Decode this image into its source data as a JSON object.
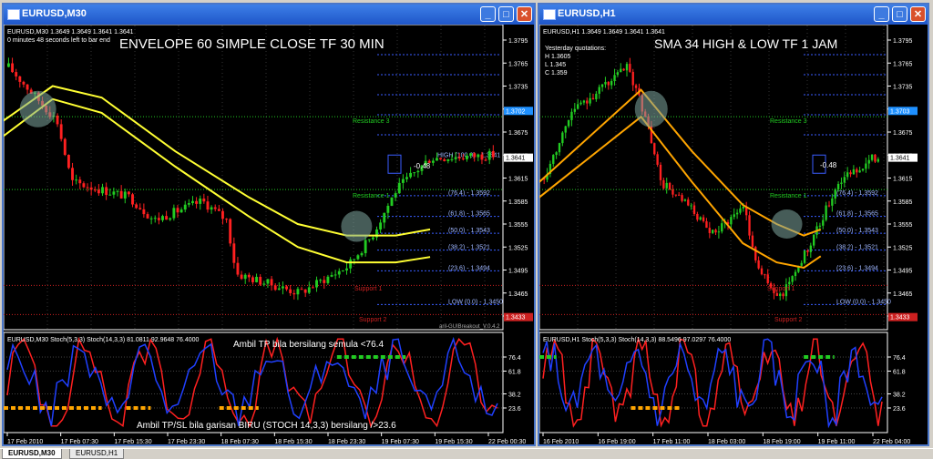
{
  "left": {
    "window_title": "EURUSD,M30",
    "symbol_line": "EURUSD,M30  1.3649 1.3649 1.3641 1.3641",
    "timer": "0 minutes 48 seconds left to bar end",
    "headline": "ENVELOPE 60 SIMPLE CLOSE TF 30 MIN",
    "price_labels": [
      "1.3795",
      "1.3765",
      "1.3735",
      "1.3705",
      "1.3675",
      "1.3645",
      "1.3615",
      "1.3585",
      "1.3555",
      "1.3525",
      "1.3495",
      "1.3465",
      "1.3435"
    ],
    "price_tag_current": "1.3641",
    "price_tag_high": "1.3702",
    "price_tag_low": "1.3433",
    "fib_labels": [
      "(76.4) - 1.3592",
      "(61.8) - 1.3565",
      "(50.0) - 1.3543",
      "(38.2) - 1.3521",
      "(23.6) - 1.3494",
      "LOW (0.0) - 1.3450"
    ],
    "high_label": "HIGH (100.0) - 1.3641",
    "pips": "-0.48",
    "resistance_3": "Resistance 3",
    "resistance_1": "Resistance 1",
    "support_1": "Support 1",
    "support_2": "Support 2",
    "breakout": "aril-GUIBreakout_V.0.4.2",
    "stoch_title": "EURUSD,M30  Stoch(5,3,3) Stoch(14,3,3) 81.0811 92.9648 76.4000",
    "stoch_levels": [
      "76.4",
      "61.8",
      "38.2",
      "23.6"
    ],
    "stoch_note_top": "Ambil TP bila bersilang semula <76.4",
    "stoch_note_bottom": "Ambil TP/SL bila garisan BIRU (STOCH 14,3,3) bersilang />23.6",
    "time_labels": [
      "17 Feb 2010",
      "17 Feb 07:30",
      "17 Feb 15:30",
      "17 Feb 23:30",
      "18 Feb 07:30",
      "18 Feb 15:30",
      "18 Feb 23:30",
      "19 Feb 07:30",
      "19 Feb 15:30",
      "22 Feb 00:30"
    ]
  },
  "right": {
    "window_title": "EURUSD,H1",
    "symbol_line": "EURUSD,H1  1.3649 1.3649 1.3641 1.3641",
    "quotes": [
      "Yesterday quotations:",
      "H 1.3605",
      "L 1.345",
      "C 1.359"
    ],
    "headline": "SMA 34 HIGH & LOW TF 1 JAM",
    "price_labels": [
      "1.3795",
      "1.3765",
      "1.3735",
      "1.3705",
      "1.3675",
      "1.3645",
      "1.3615",
      "1.3585",
      "1.3555",
      "1.3525",
      "1.3495",
      "1.3465",
      "1.3435"
    ],
    "price_tag_current": "1.3641",
    "price_tag_high": "1.3703",
    "price_tag_low": "1.3433",
    "fib_labels": [
      "(76.4) - 1.3592",
      "(61.8) - 1.3565",
      "(50.0) - 1.3543",
      "(38.2) - 1.3521",
      "(23.6) - 1.3494",
      "LOW (0.0) - 1.3450"
    ],
    "pips": "-0.48",
    "resistance_3": "Resistance 3",
    "resistance_1": "Resistance 1",
    "support_1": "Support 1",
    "support_2": "Support 2",
    "stoch_title": "EURUSD,H1  Stoch(5,3,3) Stoch(14,3,3) 88.5496 97.0297 76.4000",
    "stoch_levels": [
      "76.4",
      "61.8",
      "38.2",
      "23.6"
    ],
    "time_labels": [
      "16 Feb 2010",
      "16 Feb 19:00",
      "17 Feb 11:00",
      "18 Feb 03:00",
      "18 Feb 19:00",
      "19 Feb 11:00",
      "22 Feb 04:00"
    ]
  },
  "tabs": [
    "EURUSD,M30",
    "EURUSD,H1"
  ],
  "colors": {
    "ma": "#ffff33",
    "ma_h1": "#ffa500",
    "bull": "#22cc22",
    "bear": "#ff2020",
    "fib": "#3a5dff",
    "resistance": "#22cc22",
    "support": "#cc2020",
    "stoch_fast": "#ff2020",
    "stoch_slow": "#2040ff"
  }
}
